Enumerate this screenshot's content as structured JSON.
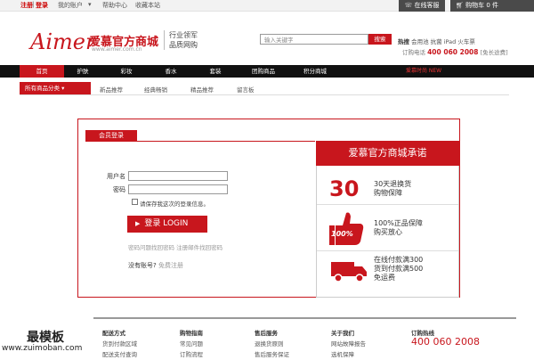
{
  "topbar": {
    "register": "注册",
    "login": "登录",
    "account": "我的账户",
    "help": "帮助中心",
    "favorite": "收藏本站",
    "service": "在线客服",
    "cart": "购物车 0 件"
  },
  "header": {
    "logo": "Aimer",
    "logo_cn": "爱慕官方商城",
    "logo_url": "www.aimer.com.cn",
    "slogan_1": "行业领军",
    "slogan_2": "品质网购",
    "search_placeholder": "输入关键字",
    "search_button": "搜索",
    "hot_label": "热搜",
    "hot_terms": "会用池 抗菌 iPad 火车票",
    "order_phone_label": "订购电话",
    "order_phone": "400 060 2008",
    "order_phone_note": "[免长途费]"
  },
  "mainnav": {
    "items": [
      "首页",
      "护肤",
      "彩妆",
      "香水",
      "套装",
      "团购商品",
      "积分商城"
    ],
    "right_text": "爱慕时尚 NEW"
  },
  "subnav": {
    "category": "所有商品分类",
    "links": [
      "新品推荐",
      "经典畅销",
      "精品推荐",
      "留言板"
    ]
  },
  "login": {
    "tab": "会员登录",
    "username_label": "用户名",
    "password_label": "密码",
    "remember": "请保存我这次的登录信息。",
    "button": "登录 LOGIN",
    "forgot": "密码问题找回密码  注册邮件找回密码",
    "no_account": "没有账号?",
    "register_free": "免费注册"
  },
  "promise": {
    "title": "爱慕官方商城承诺",
    "items": [
      {
        "badge": "30",
        "line1": "30天退换货",
        "line2": "购物保障"
      },
      {
        "badge": "100%",
        "line1": "100%正品保障",
        "line2": "购买放心"
      },
      {
        "badge": "truck",
        "line1": "在线付款满300",
        "line2": "货到付款满500",
        "line3": "免运费"
      }
    ]
  },
  "footer": {
    "columns": [
      {
        "title": "配送方式",
        "items": [
          "货到付款区域",
          "配送支付查询"
        ]
      },
      {
        "title": "购物指南",
        "items": [
          "常见问题",
          "订购流程"
        ]
      },
      {
        "title": "售后服务",
        "items": [
          "退换货原则",
          "售后服务保证"
        ]
      },
      {
        "title": "关于我们",
        "items": [
          "网站故障报告",
          "选机保障"
        ]
      }
    ],
    "hotline_title": "订购热线",
    "hotline": "400 060 2008"
  },
  "watermark": {
    "cn": "最模板",
    "url": "www.zuimoban.com"
  },
  "colors": {
    "brand_red": "#c8161d",
    "nav_black": "#111111"
  }
}
